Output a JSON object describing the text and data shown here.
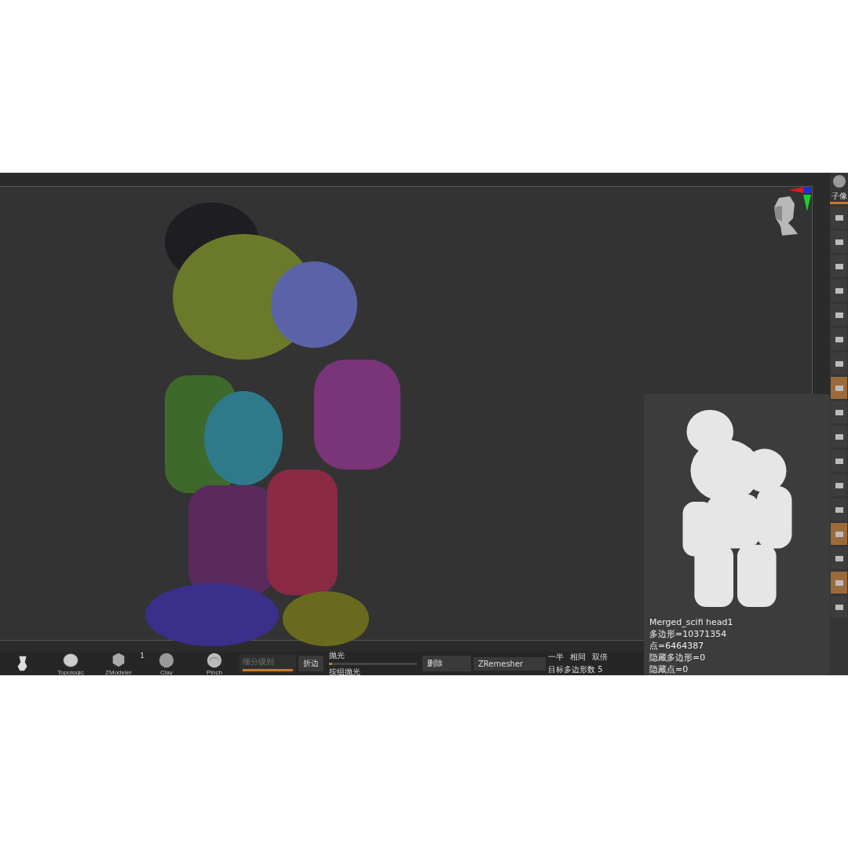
{
  "right_strip": {
    "tab": {
      "label": "子像",
      "selected": true
    },
    "tiles": [
      {
        "highlighted": false
      },
      {
        "highlighted": false
      },
      {
        "highlighted": false
      },
      {
        "highlighted": false
      },
      {
        "highlighted": false
      },
      {
        "highlighted": false
      },
      {
        "highlighted": false
      },
      {
        "highlighted": true
      },
      {
        "highlighted": false
      },
      {
        "highlighted": false
      },
      {
        "highlighted": false
      },
      {
        "highlighted": false
      },
      {
        "highlighted": false
      },
      {
        "highlighted": true
      },
      {
        "highlighted": false
      },
      {
        "highlighted": true
      },
      {
        "highlighted": false
      }
    ]
  },
  "info": {
    "name": "Merged_scifi head1",
    "lines": [
      "多边形=10371354",
      "点=6464387",
      "隐藏多边形=0",
      "隐藏点=0"
    ]
  },
  "shelf": {
    "brushes": [
      {
        "kind": "figure"
      },
      {
        "kind": "mesh",
        "label": "Topologic"
      },
      {
        "kind": "cube",
        "label": "ZModeler",
        "count": "1"
      },
      {
        "kind": "clay",
        "label": "Clay"
      },
      {
        "kind": "swirl",
        "label": "Pinch"
      }
    ],
    "subdiv": {
      "label": "细分级别",
      "disabled": true,
      "level": 1
    },
    "crease": "折边",
    "polish": {
      "label": "抛光",
      "level": 0.04
    },
    "polish_groups": "按组抛光",
    "delete": "删除",
    "zremesher": "ZRemesher",
    "target_options": [
      "一半",
      "相同",
      "双倍"
    ],
    "target": "目标多边形数 5"
  }
}
